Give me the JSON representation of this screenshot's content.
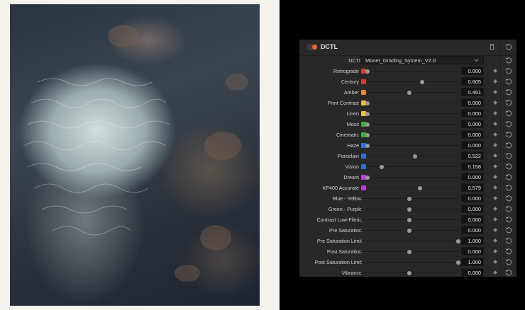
{
  "panel": {
    "title": "DCTL",
    "dctl_label": "DCTL",
    "dctl_selected": "Monet_Grading_System_V2.0",
    "accent": "#e8643a"
  },
  "params": [
    {
      "label": "Retrograde",
      "swatch": "#d93a2b",
      "value": "0.000",
      "pos": 0.0
    },
    {
      "label": "Century",
      "swatch": "#d93a2b",
      "value": "0.605",
      "pos": 0.605
    },
    {
      "label": "Amber",
      "swatch": "#ee8a22",
      "value": "0.461",
      "pos": 0.461
    },
    {
      "label": "Print Contrast",
      "swatch": "#f2c12e",
      "value": "0.000",
      "pos": 0.0
    },
    {
      "label": "Linen",
      "swatch": "#f2c12e",
      "value": "0.000",
      "pos": 0.0
    },
    {
      "label": "Moss",
      "swatch": "#3cae3a",
      "value": "0.000",
      "pos": 0.0
    },
    {
      "label": "Cinematic",
      "swatch": "#3cae3a",
      "value": "0.000",
      "pos": 0.0
    },
    {
      "label": "Haze",
      "swatch": "#2f6fe0",
      "value": "0.000",
      "pos": 0.0
    },
    {
      "label": "Porcelain",
      "swatch": "#2f6fe0",
      "value": "0.522",
      "pos": 0.522
    },
    {
      "label": "Vision",
      "swatch": "#2f6fe0",
      "value": "0.158",
      "pos": 0.158
    },
    {
      "label": "Dream",
      "swatch": "#b43fd6",
      "value": "0.000",
      "pos": 0.0
    },
    {
      "label": "KP400 Accurate",
      "swatch": "#b43fd6",
      "value": "0.579",
      "pos": 0.579
    },
    {
      "label": "Blue - Yellow",
      "swatch": "",
      "value": "0.000",
      "pos": 0.5
    },
    {
      "label": "Green - Purple",
      "swatch": "",
      "value": "0.000",
      "pos": 0.5
    },
    {
      "label": "Contrast Low-Filmic",
      "swatch": "",
      "value": "0.000",
      "pos": 0.5
    },
    {
      "label": "Pre Saturation",
      "swatch": "",
      "value": "0.000",
      "pos": 0.5
    },
    {
      "label": "Pre Saturation Limit",
      "swatch": "",
      "value": "1.000",
      "pos": 1.0
    },
    {
      "label": "Post Saturation",
      "swatch": "",
      "value": "0.000",
      "pos": 0.5
    },
    {
      "label": "Post Saturation Limit",
      "swatch": "",
      "value": "1.000",
      "pos": 1.0
    },
    {
      "label": "Vibrance",
      "swatch": "",
      "value": "0.000",
      "pos": 0.5
    }
  ],
  "icons": {
    "delete": "trash-icon",
    "reset": "reset-icon",
    "keyframe": "keyframe-diamond-icon",
    "dropdown": "chevron-down-icon"
  }
}
